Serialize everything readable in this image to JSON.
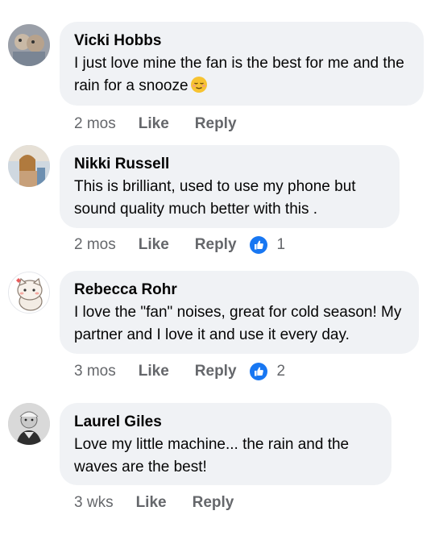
{
  "comments": [
    {
      "author": "Vicki Hobbs",
      "text": "I just love mine the fan is the best for me and the rain for a snooze",
      "emoji": "relieved-face-emoji",
      "time": "2 mos",
      "like_label": "Like",
      "reply_label": "Reply",
      "reactions": null
    },
    {
      "author": "Nikki Russell",
      "text": "This is brilliant, used to use my phone but sound quality much better with this .",
      "time": "2 mos",
      "like_label": "Like",
      "reply_label": "Reply",
      "reactions": "1"
    },
    {
      "author": "Rebecca Rohr",
      "text": "I love the \"fan\" noises, great for cold season! My partner and I love it and use it every day.",
      "time": "3 mos",
      "like_label": "Like",
      "reply_label": "Reply",
      "reactions": "2"
    },
    {
      "author": "Laurel Giles",
      "text": "Love my little machine... the rain and the waves are the best!",
      "time": "3 wks",
      "like_label": "Like",
      "reply_label": "Reply",
      "reactions": null
    }
  ],
  "colors": {
    "bubble_bg": "#f0f2f5",
    "secondary_text": "#65676b",
    "like_blue": "#1877f2"
  }
}
